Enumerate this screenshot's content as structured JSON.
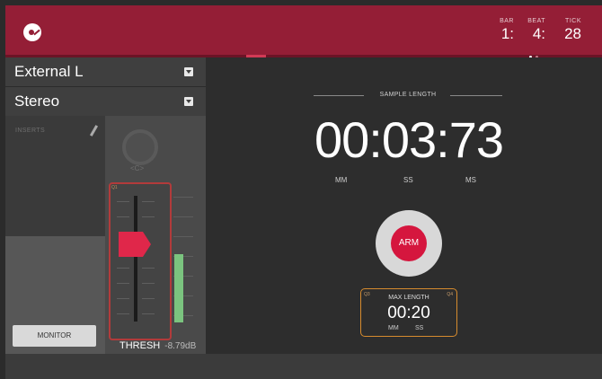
{
  "header": {
    "counters": [
      {
        "label": "BAR",
        "value": "1:"
      },
      {
        "label": "BEAT",
        "value": "4:"
      },
      {
        "label": "TICK",
        "value": "28"
      }
    ]
  },
  "input": {
    "source": "External L",
    "mode": "Stereo"
  },
  "inserts": {
    "label": "INSERTS"
  },
  "monitor": {
    "label": "MONITOR"
  },
  "pan": {
    "value": "<C>"
  },
  "threshold": {
    "label": "THRESH",
    "value": "-8.79dB",
    "tag_tl": "Q1"
  },
  "sample": {
    "title": "SAMPLE LENGTH",
    "time": "00:03:73",
    "units": [
      "MM",
      "SS",
      "MS"
    ]
  },
  "arm": {
    "label": "ARM"
  },
  "max_length": {
    "title": "MAX LENGTH",
    "time": "00:20",
    "units": [
      "MM",
      "SS"
    ],
    "tag_left": "Q3",
    "tag_right": "Q4"
  },
  "colors": {
    "accent": "#941e36",
    "arm": "#d5163e",
    "meter": "#7bc47f",
    "outline": "#d68b2e"
  }
}
